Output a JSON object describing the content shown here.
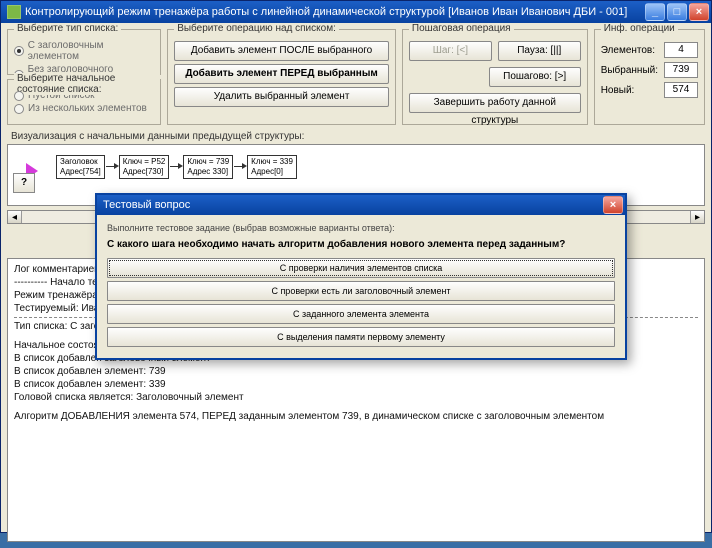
{
  "title": "Контролирующий режим тренажёра работы с линейной динамической структурой [Иванов Иван Иванович ДБИ - 001]",
  "groups": {
    "listtype": {
      "label": "Выберите тип списка:",
      "opts": [
        "С заголовочным элементом",
        "Без заголовочного элемента"
      ]
    },
    "initstate": {
      "label": "Выберите начальное состояние списка:",
      "opts": [
        "Пустой список",
        "Из нескольких элементов"
      ]
    },
    "ops": {
      "label": "Выберите операцию над списком:",
      "btn_after": "Добавить элемент ПОСЛЕ выбранного",
      "btn_before": "Добавить элемент ПЕРЕД выбранным",
      "btn_del": "Удалить выбранный элемент"
    },
    "step": {
      "label": "Пошаговая операция",
      "undo": "Шаг: [<]",
      "pause": "Пауза: [||]",
      "stepbtn": "Пошагово: [>]",
      "finish": "Завершить работу данной структуры"
    },
    "info": {
      "label": "Инф. операции",
      "elements_l": "Элементов:",
      "elements_v": "4",
      "selected_l": "Выбранный:",
      "selected_v": "739",
      "new_l": "Новый:",
      "new_v": "574"
    }
  },
  "canvas_label": "Визуализация с начальными данными предыдущей структуры:",
  "nodes": [
    {
      "l1": "Заголовок",
      "l2": "Адрес[754]"
    },
    {
      "l1": "Ключ = P52",
      "l2": "Адрес[730]"
    },
    {
      "l1": "Ключ = 739",
      "l2": "Адрес 330]"
    },
    {
      "l1": "Ключ = 339",
      "l2": "Адрес[0]"
    }
  ],
  "help": "?",
  "log": {
    "t0": "Лог комментариев:",
    "t1": "---------- Начало тестирования ----------",
    "t2": "Режим тренажёра: Контролирующий",
    "t3": "Тестируемый: Иванов Иван Иванович ДБИ - 001",
    "t4": "Тип списка: С заголовочным элементом",
    "t5": "Начальное состояние: Из нескольких элементов",
    "t6": "В список добавлен заголовочный элемент",
    "t7": "В список добавлен элемент: 739",
    "t8": "В список добавлен элемент: 339",
    "t9": "Головой списка является: Заголовочный элемент",
    "t10": "Алгоритм ДОБАВЛЕНИЯ элемента 574, ПЕРЕД заданным элементом 739, в динамическом списке с заголовочным элементом"
  },
  "modal": {
    "title": "Тестовый вопрос",
    "hint": "Выполните тестовое задание (выбрав возможные варианты ответа):",
    "q": "С какого шага необходимо начать алгоритм добавления нового элемента перед заданным?",
    "opts": [
      "С проверки наличия элементов списка",
      "С проверки есть ли заголовочный элемент",
      "С заданного элемента элемента",
      "С выделения памяти первому элементу"
    ]
  }
}
